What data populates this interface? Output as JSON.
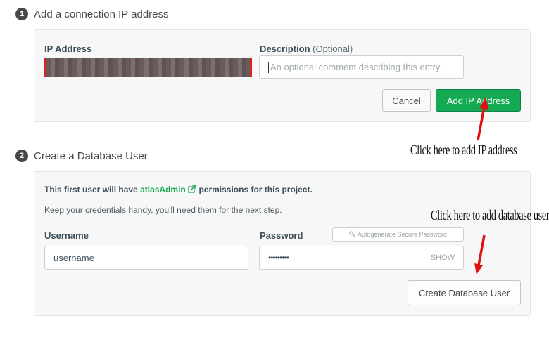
{
  "step1": {
    "number": "1",
    "title": "Add a connection IP address",
    "ip_label": "IP Address",
    "desc_label": "Description",
    "desc_optional": "(Optional)",
    "desc_placeholder": "An optional comment describing this entry",
    "cancel_label": "Cancel",
    "add_ip_label": "Add IP Address"
  },
  "step2": {
    "number": "2",
    "title": "Create a Database User",
    "intro_prefix": "This first user will have",
    "intro_role": "atlasAdmin",
    "intro_suffix": "permissions for this project.",
    "note": "Keep your credentials handy, you'll need them for the next step.",
    "username_label": "Username",
    "username_value": "username",
    "password_label": "Password",
    "password_value": "•••••••••",
    "autogenerate_label": "Autogenerate Secure Password",
    "show_label": "SHOW",
    "create_user_label": "Create Database User"
  },
  "annotations": {
    "ip_note": "Click here to add IP address",
    "user_note": "Click here to add database user"
  },
  "colors": {
    "accent_green": "#13aa52",
    "annotation_red": "#dd1111"
  },
  "icons": [
    "external-link-icon",
    "key-icon",
    "arrow-icon"
  ]
}
